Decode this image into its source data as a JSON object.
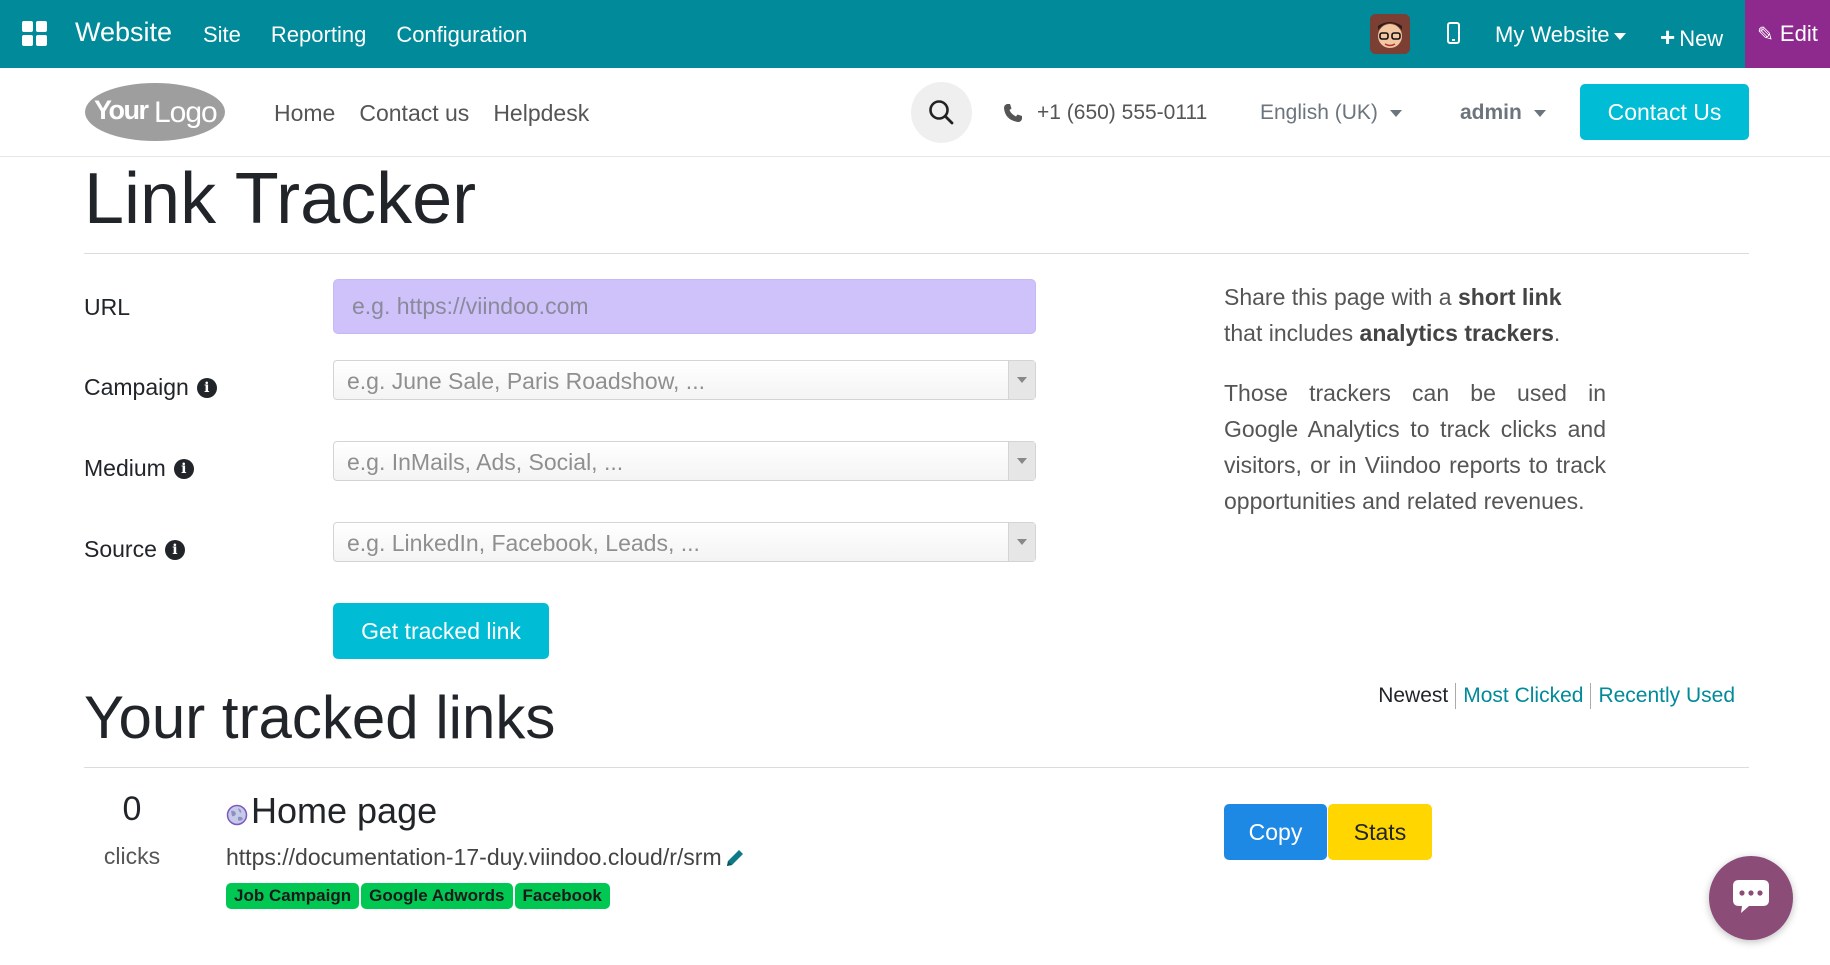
{
  "topbar": {
    "brand": "Website",
    "menu": [
      "Site",
      "Reporting",
      "Configuration"
    ],
    "my_website": "My Website",
    "new_label": "New",
    "edit_label": "Edit"
  },
  "header": {
    "logo_text": {
      "bold": "Your",
      "light": "Logo"
    },
    "nav": [
      "Home",
      "Contact us",
      "Helpdesk"
    ],
    "phone": "+1 (650) 555-0111",
    "language": "English (UK)",
    "user": "admin",
    "contact_button": "Contact Us"
  },
  "page": {
    "title": "Link Tracker",
    "form": {
      "url_label": "URL",
      "url_placeholder": "e.g. https://viindoo.com",
      "campaign_label": "Campaign",
      "campaign_placeholder": "e.g. June Sale, Paris Roadshow, ...",
      "medium_label": "Medium",
      "medium_placeholder": "e.g. InMails, Ads, Social, ...",
      "source_label": "Source",
      "source_placeholder": "e.g. LinkedIn, Facebook, Leads, ...",
      "submit": "Get tracked link"
    },
    "side": {
      "p1_a": "Share this page with a ",
      "p1_b": "short link",
      "p1_c": " that includes ",
      "p1_d": "analytics trackers",
      "p1_e": ".",
      "p2": "Those trackers can be used in Google Analytics to track clicks and visitors, or in Viindoo reports to track opportunities and related revenues."
    }
  },
  "tracked": {
    "title": "Your tracked links",
    "sort": [
      "Newest",
      "Most Clicked",
      "Recently Used"
    ],
    "links": [
      {
        "clicks": "0",
        "clicks_label": "clicks",
        "title": "Home page",
        "short_url": "https://documentation-17-duy.viindoo.cloud/r/srm",
        "tags": [
          "Job Campaign",
          "Google Adwords",
          "Facebook"
        ],
        "copy": "Copy",
        "stats": "Stats"
      }
    ]
  },
  "colors": {
    "topbar": "#018a99",
    "edit": "#8e2a8e",
    "primary": "#00bcd4",
    "copy": "#1e88e5",
    "stats": "#ffd600",
    "tag": "#00c853",
    "chat": "#8b4d78"
  },
  "icons": [
    "apps-icon",
    "mobile-icon",
    "plus-icon",
    "pencil-icon",
    "search-icon",
    "phone-icon",
    "info-icon",
    "globe-icon",
    "chat-icon"
  ]
}
